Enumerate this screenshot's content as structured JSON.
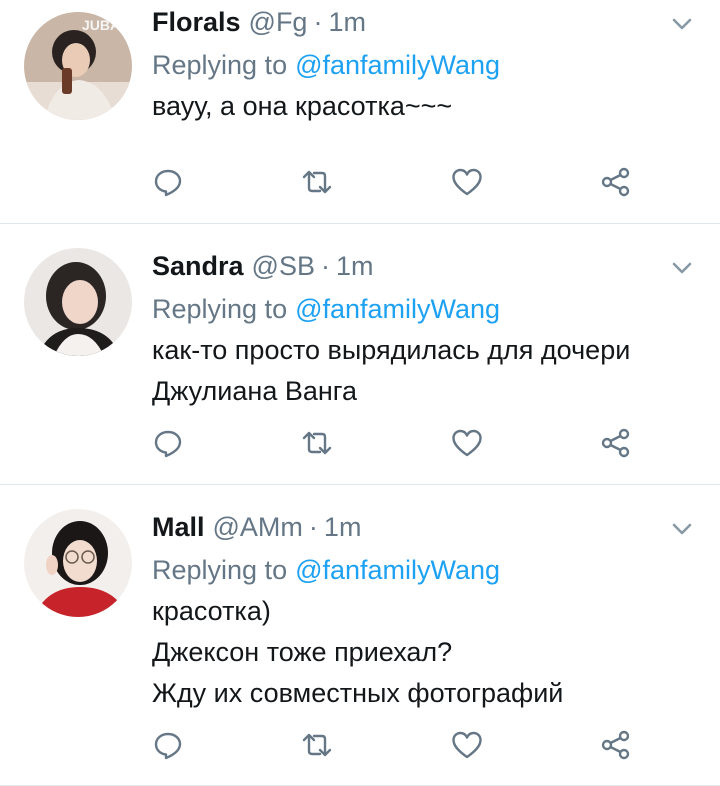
{
  "tweets": [
    {
      "name": "Florals",
      "handle": "@Fg",
      "separator": "·",
      "time": "1m",
      "replying_prefix": "Replying to",
      "replying_to": "@fanfamilyWang",
      "text_lines": [
        "вауу, а она красотка~~~"
      ],
      "avatar_overlay_text": "JUBA"
    },
    {
      "name": "Sandra",
      "handle": "@SB",
      "separator": "·",
      "time": "1m",
      "replying_prefix": "Replying to",
      "replying_to": "@fanfamilyWang",
      "text_lines": [
        "как-то просто вырядилась для дочери",
        "Джулиана Ванга"
      ]
    },
    {
      "name": "Mall",
      "handle": "@AMm",
      "separator": "·",
      "time": "1m",
      "replying_prefix": "Replying to",
      "replying_to": "@fanfamilyWang",
      "text_lines": [
        "красотка)",
        "Джексон тоже приехал?",
        "Жду их совместных фотографий"
      ]
    }
  ],
  "icons": {
    "reply": "reply-icon",
    "retweet": "retweet-icon",
    "like": "heart-icon",
    "share": "share-icon",
    "menu": "chevron-down-icon"
  },
  "colors": {
    "mention": "#1da1f2",
    "secondary_text": "#657786",
    "icon": "#657786",
    "divider": "#e1e8ed"
  }
}
